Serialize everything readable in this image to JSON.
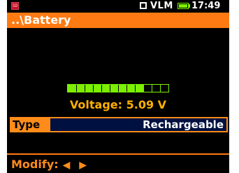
{
  "status_bar": {
    "app_badge": "SD",
    "mode": "VLM",
    "time": "17:49",
    "battery_icon": "battery-icon"
  },
  "title_bar": {
    "path": "..\\Battery"
  },
  "battery_level": {
    "segments_total": 12,
    "segments_filled": 9
  },
  "voltage": {
    "text": "Voltage:  5.09 V"
  },
  "type_setting": {
    "label": "Type",
    "value": "Rechargeable"
  },
  "footer": {
    "modify_label": "Modify:",
    "arrows": "◀ ▶"
  },
  "colors": {
    "accent_orange": "#ff7a12",
    "level_green": "#7cf000",
    "voltage_amber": "#ffb000",
    "selected_value_bg": "#001040"
  }
}
